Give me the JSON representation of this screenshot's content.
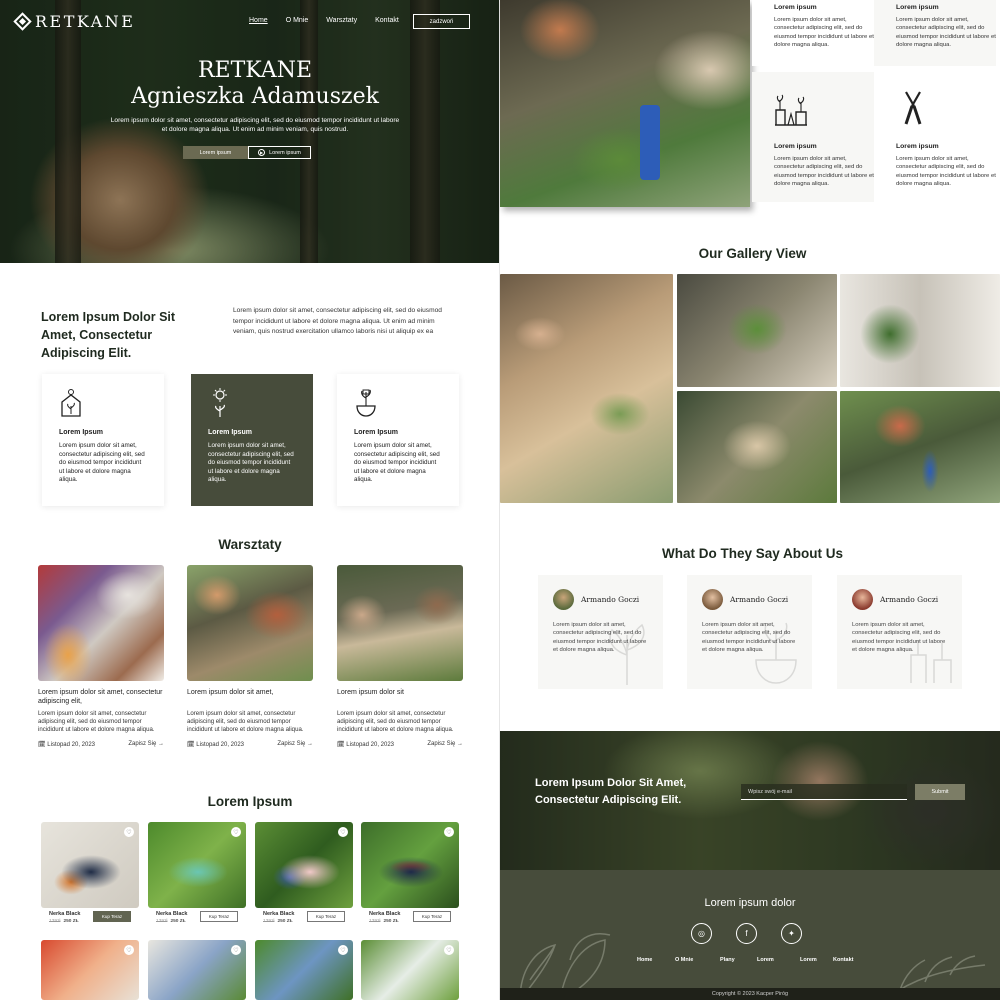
{
  "header": {
    "logo": "RETKANE",
    "nav": [
      "Home",
      "O Mnie",
      "Warsztaty",
      "Kontakt"
    ],
    "cta": "zadzwoń"
  },
  "hero": {
    "title_line1": "RETKANE",
    "title_line2": "Agnieszka Adamuszek",
    "text": "Lorem ipsum dolor sit amet, consectetur adipiscing elit, sed do eiusmod tempor incididunt ut labore et dolore magna aliqua. Ut enim ad minim veniam, quis nostrud.",
    "btn_primary": "Lorem ipsum",
    "btn_secondary": "Lorem ipsum"
  },
  "about": {
    "title": "Lorem Ipsum Dolor Sit Amet, Consectetur Adipiscing Elit.",
    "text": "Lorem ipsum dolor sit amet, consectetur adipiscing elit, sed do eiusmod tempor incididunt ut labore et dolore magna aliqua. Ut enim ad minim veniam, quis nostrud exercitation ullamco laboris nisi ut aliquip ex ea"
  },
  "features": [
    {
      "icon": "house-sprout-icon",
      "title": "Lorem Ipsum",
      "text": "Lorem ipsum dolor sit amet, consectetur adipiscing elit, sed do eiusmod tempor incididunt ut labore et dolore magna aliqua."
    },
    {
      "icon": "sun-sprout-icon",
      "title": "Lorem Ipsum",
      "text": "Lorem ipsum dolor sit amet, consectetur adipiscing elit, sed do eiusmod tempor incididunt ut labore et dolore magna aliqua."
    },
    {
      "icon": "plant-pot-icon",
      "title": "Lorem Ipsum",
      "text": "Lorem ipsum dolor sit amet, consectetur adipiscing elit, sed do eiusmod tempor incididunt ut labore et dolore magna aliqua."
    }
  ],
  "workshops": {
    "title": "Warsztaty",
    "items": [
      {
        "title": "Lorem ipsum dolor sit amet, consectetur adipiscing elit,",
        "text": "Lorem ipsum dolor sit amet, consectetur adipiscing elit, sed do eiusmod tempor incididunt ut labore et dolore magna aliqua.",
        "date": "Listopad 20, 2023",
        "link": "Zapisz Się"
      },
      {
        "title": "Lorem ipsum dolor sit amet,",
        "text": "Lorem ipsum dolor sit amet, consectetur adipiscing elit, sed do eiusmod tempor incididunt ut labore et dolore magna aliqua.",
        "date": "Listopad 20, 2023",
        "link": "Zapisz Się"
      },
      {
        "title": "Lorem ipsum dolor sit",
        "text": "Lorem ipsum dolor sit amet, consectetur adipiscing elit, sed do eiusmod tempor incididunt ut labore et dolore magna aliqua.",
        "date": "Listopad 20, 2023",
        "link": "Zapisz Się"
      }
    ]
  },
  "shop": {
    "title": "Lorem Ipsum",
    "products": [
      {
        "name": "Nerka Black",
        "old_price": "139zł",
        "price": "250 ZŁ",
        "button": "Kup Teraz"
      },
      {
        "name": "Nerka Black",
        "old_price": "139zł",
        "price": "250 ZŁ",
        "button": "Kup Teraz"
      },
      {
        "name": "Nerka Black",
        "old_price": "139zł",
        "price": "250 ZŁ",
        "button": "Kup Teraz"
      },
      {
        "name": "Nerka Black",
        "old_price": "139zł",
        "price": "250 ZŁ",
        "button": "Kup Teraz"
      }
    ]
  },
  "services": [
    {
      "title": "Lorem ipsum",
      "text": "Lorem ipsum dolor sit amet, consectetur adipiscing elit, sed do eiusmod tempor incididunt ut labore et dolore magna aliqua."
    },
    {
      "title": "Lorem ipsum",
      "text": "Lorem ipsum dolor sit amet, consectetur adipiscing elit, sed do eiusmod tempor incididunt ut labore et dolore magna aliqua."
    },
    {
      "title": "Lorem ipsum",
      "icon": "chemistry-plants-icon",
      "text": "Lorem ipsum dolor sit amet, consectetur adipiscing elit, sed do eiusmod tempor incididunt ut labore et dolore magna aliqua."
    },
    {
      "title": "Lorem ipsum",
      "icon": "pruning-shears-icon",
      "text": "Lorem ipsum dolor sit amet, consectetur adipiscing elit, sed do eiusmod tempor incididunt ut labore et dolore magna aliqua."
    }
  ],
  "gallery": {
    "title": "Our Gallery View"
  },
  "testimonials": {
    "title": "What Do They Say About Us",
    "items": [
      {
        "name": "Armando Goczi",
        "text": "Lorem ipsum dolor sit amet, consectetur adipiscing elit, sed do eiusmod tempor incididunt ut labore et dolore magna aliqua."
      },
      {
        "name": "Armando Goczi",
        "text": "Lorem ipsum dolor sit amet, consectetur adipiscing elit, sed do eiusmod tempor incididunt ut labore et dolore magna aliqua."
      },
      {
        "name": "Armando Goczi",
        "text": "Lorem ipsum dolor sit amet, consectetur adipiscing elit, sed do eiusmod tempor incididunt ut labore et dolore magna aliqua."
      }
    ]
  },
  "newsletter": {
    "title": "Lorem Ipsum Dolor Sit Amet, Consectetur Adipiscing Elit.",
    "placeholder": "Wpisz swój e-mail",
    "button": "Submit"
  },
  "footer": {
    "title": "Lorem ipsum dolor",
    "social": [
      "instagram-icon",
      "facebook-icon",
      "twitter-icon"
    ],
    "nav": [
      "Home",
      "O Mnie",
      "Plany",
      "Lorem",
      "Lorem",
      "Kontakt"
    ],
    "copyright": "Copyright © 2023 Kacper Piróg"
  },
  "colors": {
    "accent": "#474c3b",
    "button": "#6b6a52",
    "heading": "#1f2a1f"
  }
}
